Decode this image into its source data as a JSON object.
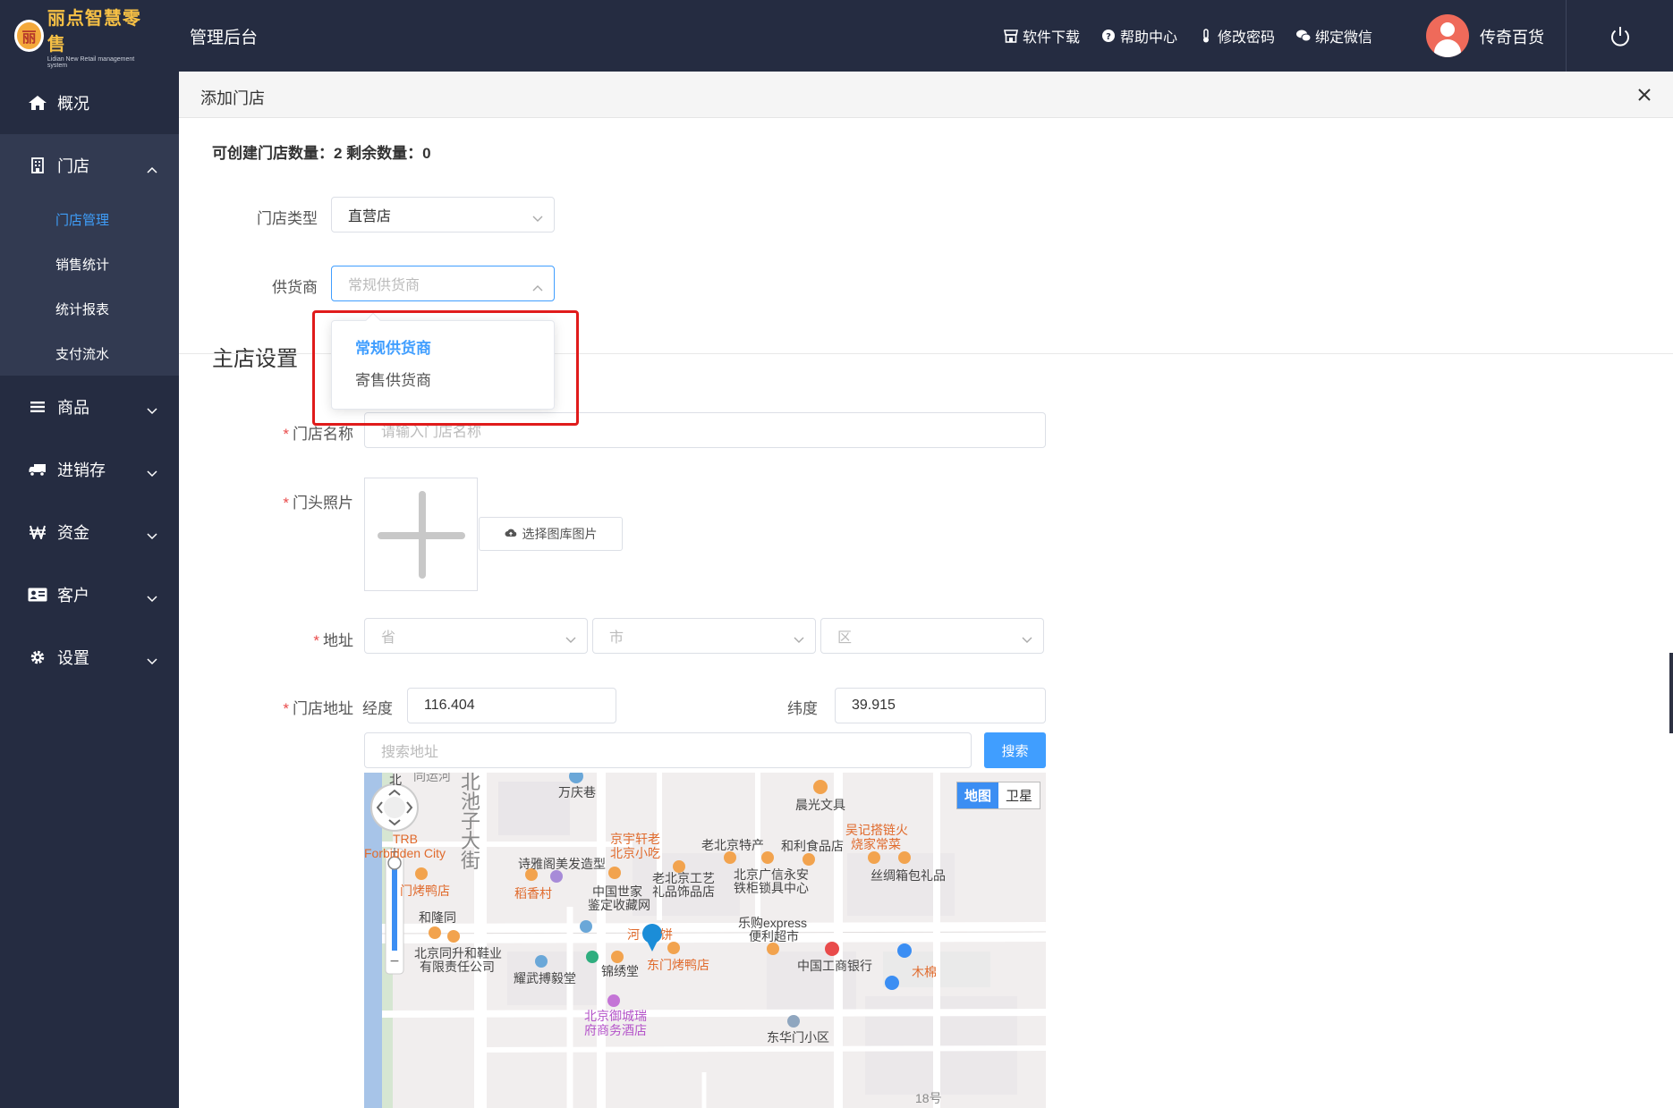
{
  "brand": {
    "logo_badge": "丽",
    "logo_text": "丽点智慧零售",
    "logo_sub": "Lidian New Retail management system",
    "app_title": "管理后台"
  },
  "header": {
    "links": [
      {
        "label": "软件下载",
        "icon": "store-icon"
      },
      {
        "label": "帮助中心",
        "icon": "help-circle-icon"
      },
      {
        "label": "修改密码",
        "icon": "thermometer-icon"
      },
      {
        "label": "绑定微信",
        "icon": "chat-bubbles-icon"
      }
    ],
    "user_name": "传奇百货",
    "power_icon": "power-icon"
  },
  "sidebar": {
    "items": [
      {
        "label": "概况",
        "icon": "home-icon"
      },
      {
        "label": "门店",
        "icon": "building-icon"
      },
      {
        "label": "商品",
        "icon": "list-icon"
      },
      {
        "label": "进销存",
        "icon": "truck-icon"
      },
      {
        "label": "资金",
        "icon": "won-icon"
      },
      {
        "label": "客户",
        "icon": "id-card-icon"
      },
      {
        "label": "设置",
        "icon": "gear-icon"
      }
    ],
    "store_sub": [
      "门店管理",
      "销售统计",
      "统计报表",
      "支付流水"
    ]
  },
  "panel": {
    "title": "添加门店",
    "quota": "可创建门店数量：2 剩余数量：0",
    "store_type_label": "门店类型",
    "store_type_value": "直营店",
    "supplier_label": "供货商",
    "supplier_placeholder": "常规供货商",
    "supplier_options": [
      "常规供货商",
      "寄售供货商"
    ],
    "section_title": "主店设置",
    "store_name_label": "门店名称",
    "store_name_placeholder": "请输入门店名称",
    "photo_label": "门头照片",
    "pick_image_label": "选择图库图片",
    "address_label": "地址",
    "province_placeholder": "省",
    "city_placeholder": "市",
    "district_placeholder": "区",
    "store_address_label": "门店地址",
    "lng_label": "经度",
    "lng_value": "116.404",
    "lat_label": "纬度",
    "lat_value": "39.915",
    "search_placeholder": "搜索地址",
    "search_button": "搜索"
  },
  "map": {
    "type_map": "地图",
    "type_satellite": "卫星",
    "north_label": "北",
    "pois": [
      "万庆巷",
      "晨光文具",
      "吴记搭链火",
      "烧家常菜",
      "京宇轩老",
      "北京小吃",
      "老北京特产",
      "和利食品店",
      "TRB",
      "Forbidden City",
      "诗雅阁美发造型",
      "北京广信永安",
      "铁柜锁具中心",
      "丝绸箱包礼品",
      "门烤鸭店",
      "中国世家",
      "鉴定收藏网",
      "老北京工艺",
      "礼品饰品店",
      "稻香村",
      "和隆同",
      "乐购express",
      "便利超市",
      "北京同升和鞋业",
      "有限责任公司",
      "河",
      "饼",
      "东门烤鸭店",
      "中国工商银行",
      "耀武搏毅堂",
      "锦绣堂",
      "木棉",
      "北京御城瑞",
      "府商务酒店",
      "东华门小区",
      "18号",
      "同运河",
      "北池子大街"
    ]
  }
}
